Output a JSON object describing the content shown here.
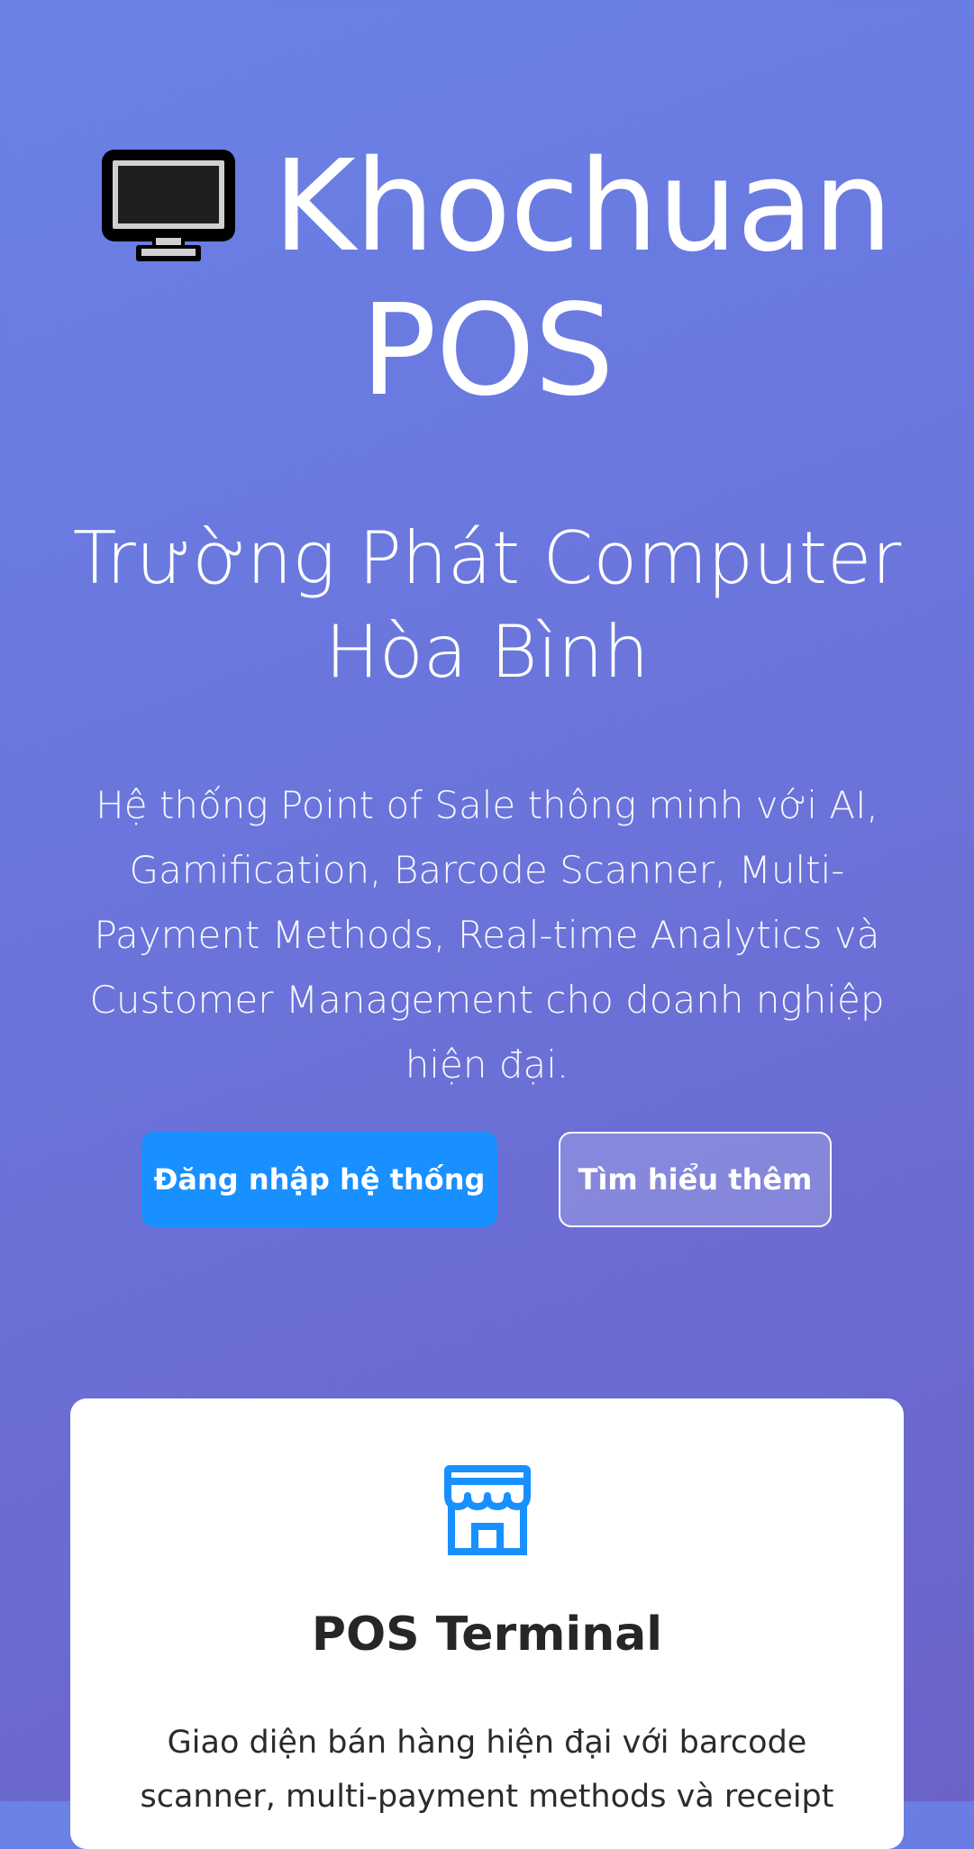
{
  "hero": {
    "icon": "desktop-monitor-icon",
    "brand_line1": "Khochuan",
    "brand_line2": "POS",
    "company_line1": "Trường Phát Computer",
    "company_line2": "Hòa Bình",
    "description": "Hệ thống Point of Sale thông minh với AI, Gamification, Barcode Scanner, Multi-Payment Methods, Real-time Analytics và Customer Management cho doanh nghiệp hiện đại."
  },
  "buttons": {
    "login_label": "Đăng nhập hệ thống",
    "learn_more_label": "Tìm hiểu thêm"
  },
  "features": [
    {
      "icon": "shop-icon",
      "title": "POS Terminal",
      "description": "Giao diện bán hàng hiện đại với barcode scanner, multi-payment methods và receipt"
    }
  ],
  "colors": {
    "primary": "#1890ff",
    "gradient_start": "#6a82e6",
    "gradient_end": "#6b63c8"
  }
}
